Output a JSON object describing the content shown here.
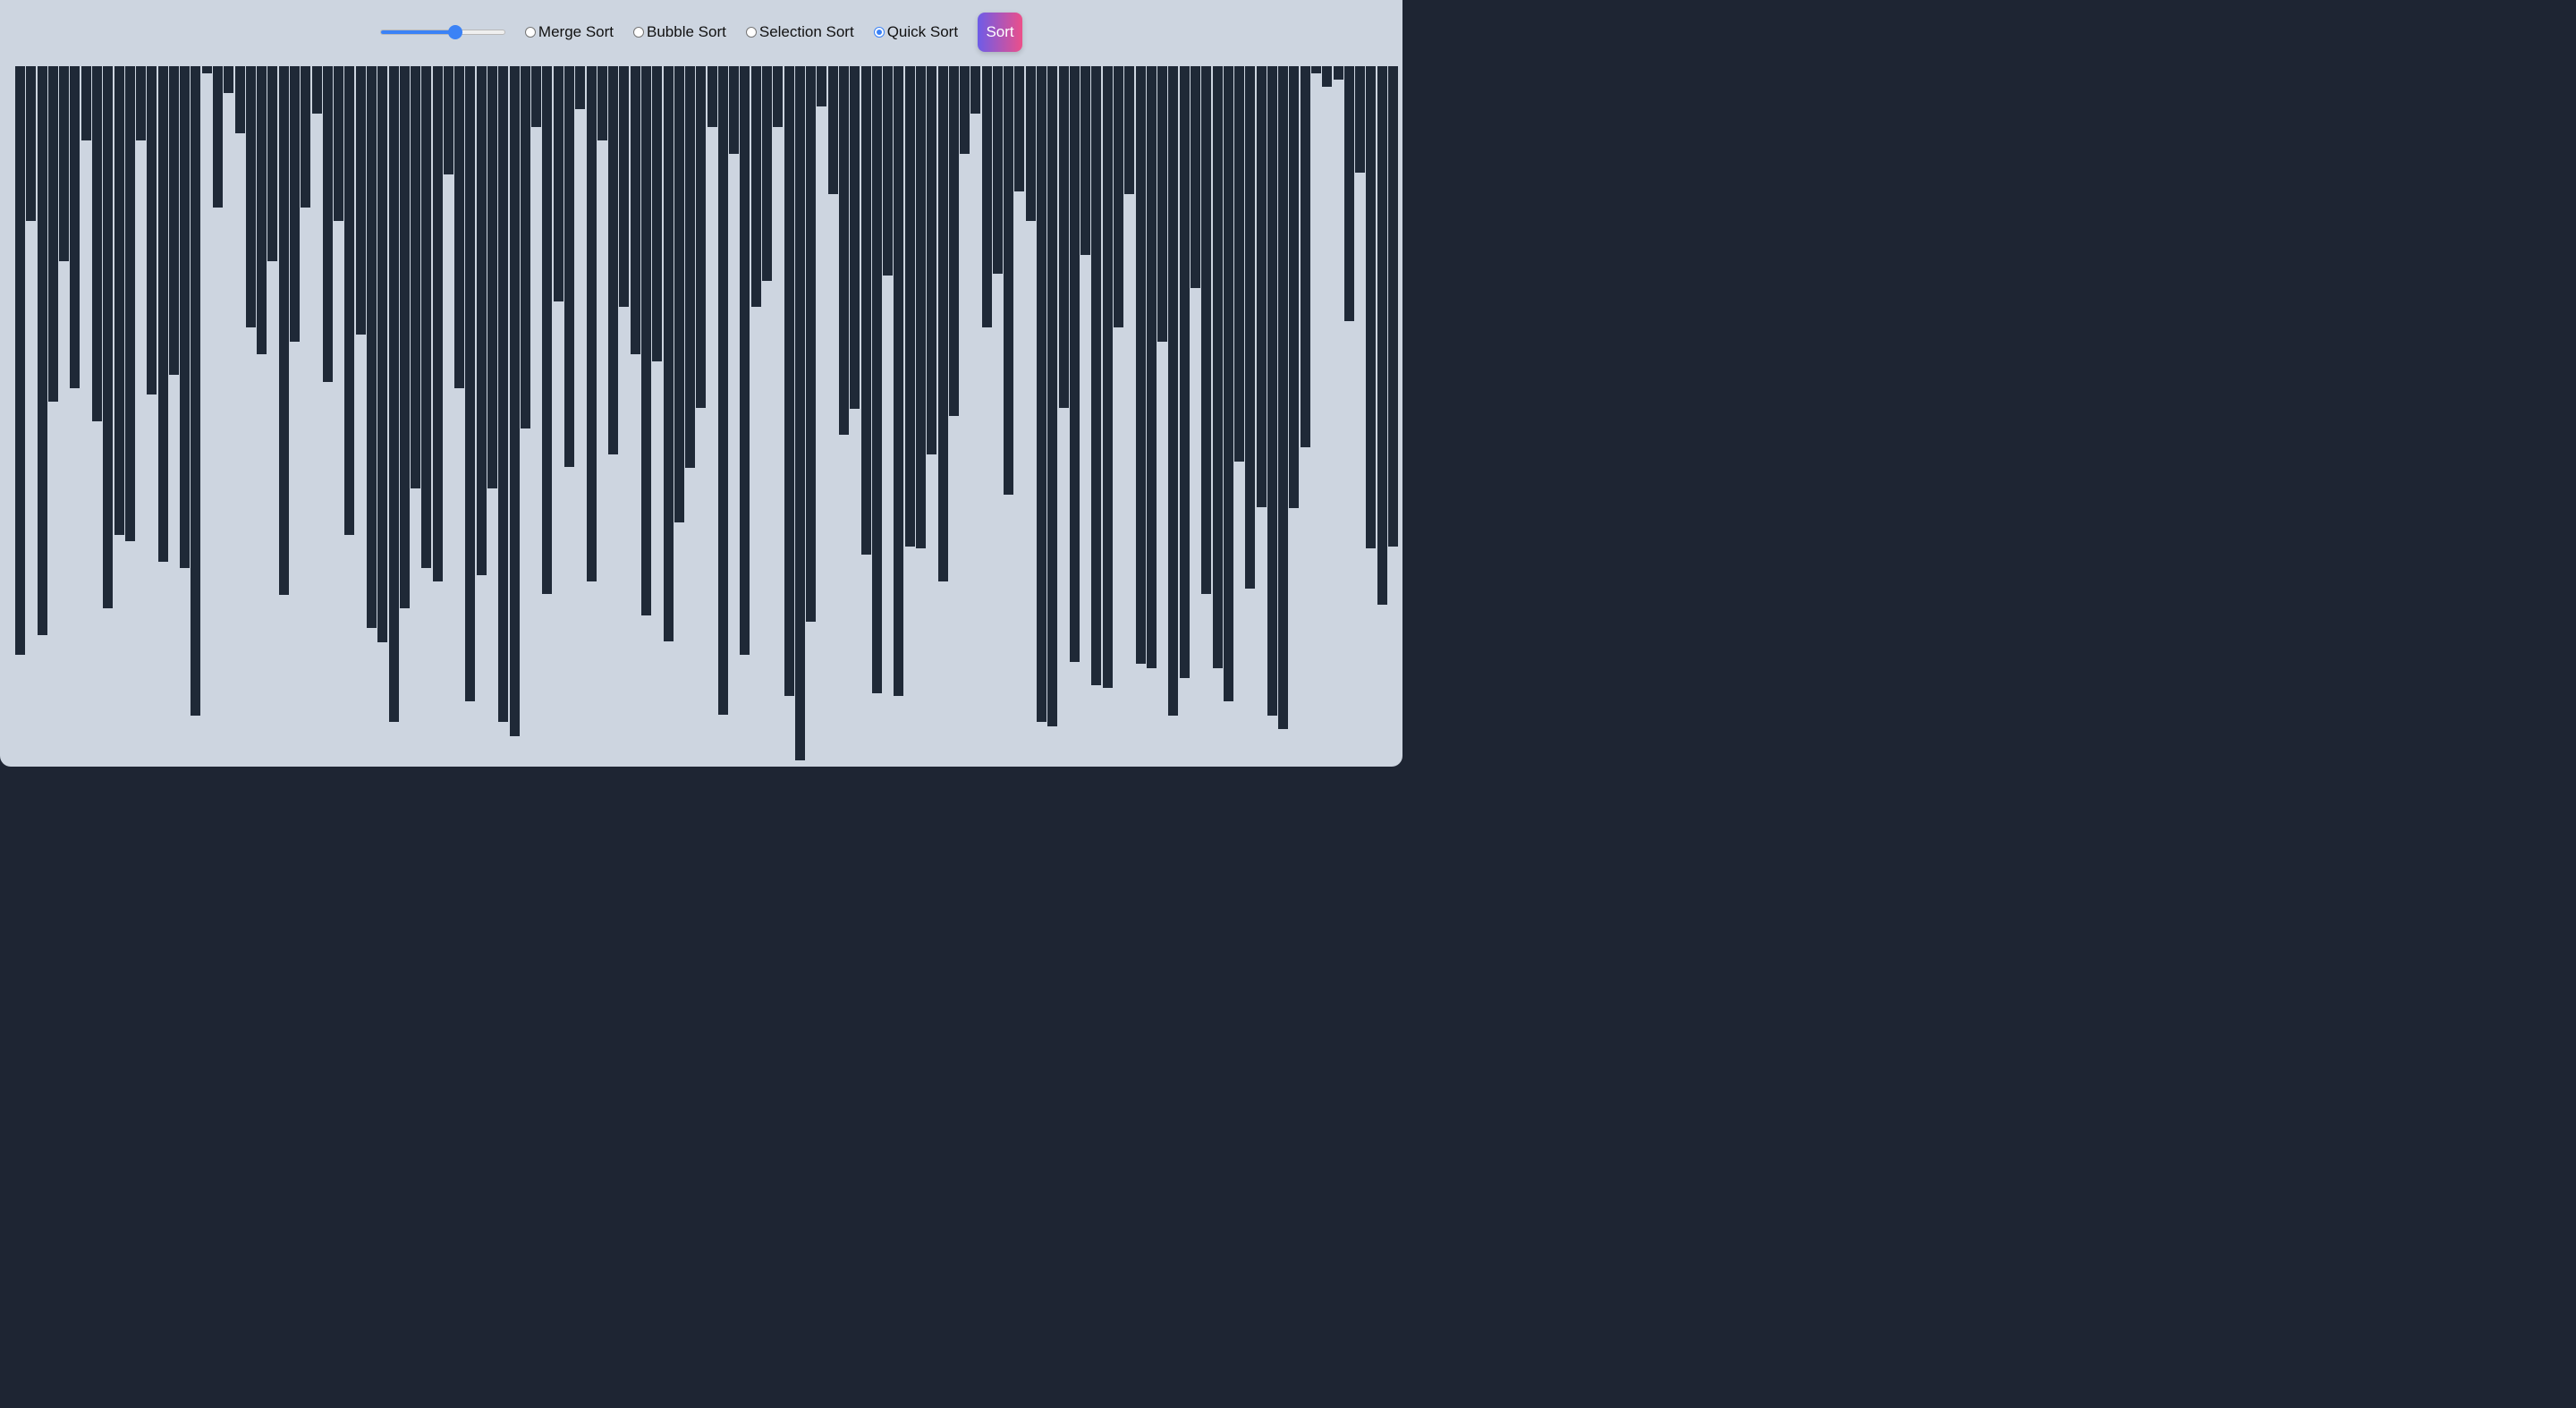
{
  "controls": {
    "size_slider": {
      "value": 0.61
    },
    "algorithms": [
      {
        "label": "Merge Sort",
        "checked": false
      },
      {
        "label": "Bubble Sort",
        "checked": false
      },
      {
        "label": "Selection Sort",
        "checked": false
      },
      {
        "label": "Quick Sort",
        "checked": true
      }
    ],
    "sort_label": "Sort"
  },
  "colors": {
    "background": "#cdd5e0",
    "bar": "#1f2937",
    "accent": "#3b82f6",
    "button_gradient_start": "#6d5ce8",
    "button_gradient_end": "#ec4f8a"
  },
  "bars": {
    "max": 760,
    "values": [
      658,
      173,
      636,
      375,
      218,
      360,
      83,
      397,
      606,
      524,
      531,
      83,
      367,
      554,
      345,
      561,
      726,
      8,
      158,
      30,
      75,
      292,
      322,
      218,
      591,
      308,
      158,
      53,
      353,
      173,
      524,
      300,
      628,
      644,
      733,
      606,
      472,
      561,
      576,
      121,
      360,
      710,
      569,
      472,
      733,
      749,
      405,
      68,
      590,
      263,
      448,
      48,
      576,
      83,
      434,
      269,
      322,
      614,
      330,
      643,
      510,
      449,
      382,
      68,
      725,
      98,
      658,
      269,
      240,
      68,
      704,
      776,
      621,
      45,
      143,
      412,
      383,
      546,
      701,
      234,
      704,
      537,
      539,
      434,
      576,
      391,
      98,
      53,
      292,
      232,
      479,
      140,
      173,
      733,
      738,
      382,
      666,
      211,
      692,
      695,
      292,
      143,
      668,
      673,
      308,
      726,
      684,
      248,
      590,
      673,
      710,
      442,
      584,
      493,
      726,
      741,
      494,
      426,
      8,
      23,
      15,
      285,
      119,
      539,
      602,
      537
    ],
    "display": "vertical bar array (top-anchored)"
  }
}
